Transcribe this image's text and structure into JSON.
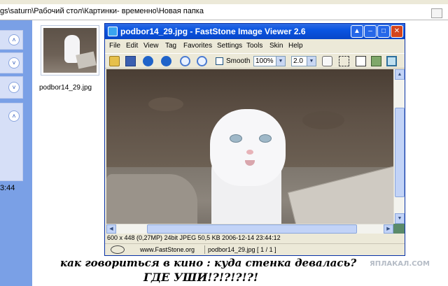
{
  "explorer": {
    "address_path": "gs\\saturn\\Рабочий стол\\Картинки- временно\\Новая папка",
    "task_time": "3:44",
    "thumbnail_label": "podbor14_29.jpg"
  },
  "viewer": {
    "title": "podbor14_29.jpg - FastStone Image Viewer 2.6",
    "menu": [
      "File",
      "Edit",
      "View",
      "Tag",
      "Favorites",
      "Settings",
      "Tools",
      "Skin",
      "Help"
    ],
    "toolbar": {
      "smooth_label": "Smooth",
      "zoom_value": "100%",
      "gamma_value": "2.0"
    },
    "status": {
      "info": "600 x 448 (0,27MP)    24bit JPEG    50,5 KB    2006-12-14 23:44:12",
      "site": "www.FastStone.org",
      "file": "podbor14_29.jpg [ 1 / 1 ]"
    },
    "icons": {
      "minimize": "minimize-icon",
      "maximize": "maximize-icon",
      "close": "close-icon"
    }
  },
  "caption": {
    "line1": "как говориться в кино : куда стенка девалась?",
    "line2": "ГДЕ УШИ!?!?!?!?!"
  },
  "watermark": "ЯПЛАКАЛ.COM",
  "colors": {
    "titlebar": "#0a55e2",
    "close_button": "#d4451c",
    "window_face": "#ece9d8"
  }
}
